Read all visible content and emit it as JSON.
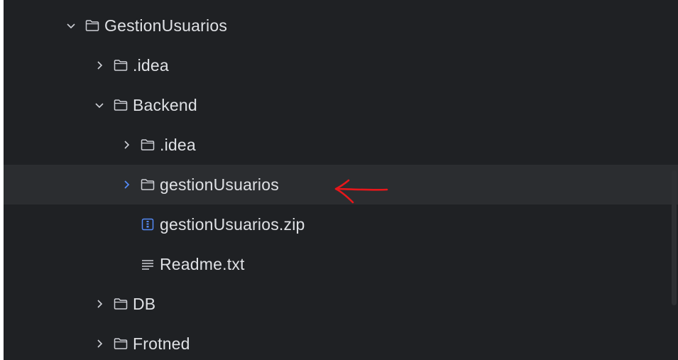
{
  "tree": {
    "items": [
      {
        "label": "GestionUsuarios",
        "type": "folder",
        "expanded": true
      },
      {
        "label": ".idea",
        "type": "folder",
        "expanded": false
      },
      {
        "label": "Backend",
        "type": "folder",
        "expanded": true
      },
      {
        "label": ".idea",
        "type": "folder",
        "expanded": false
      },
      {
        "label": "gestionUsuarios",
        "type": "folder",
        "expanded": false,
        "selected": true
      },
      {
        "label": "gestionUsuarios.zip",
        "type": "archive"
      },
      {
        "label": "Readme.txt",
        "type": "text-file"
      },
      {
        "label": "DB",
        "type": "folder",
        "expanded": false
      },
      {
        "label": "Frotned",
        "type": "folder",
        "expanded": false
      }
    ]
  },
  "colors": {
    "background": "#1f2124",
    "selected_row": "#2b2d30",
    "text": "#dfe1e5",
    "icon": "#ced0d6",
    "selected_arrow": "#548af7",
    "archive_icon": "#548af7",
    "annotation": "#e8171b"
  }
}
